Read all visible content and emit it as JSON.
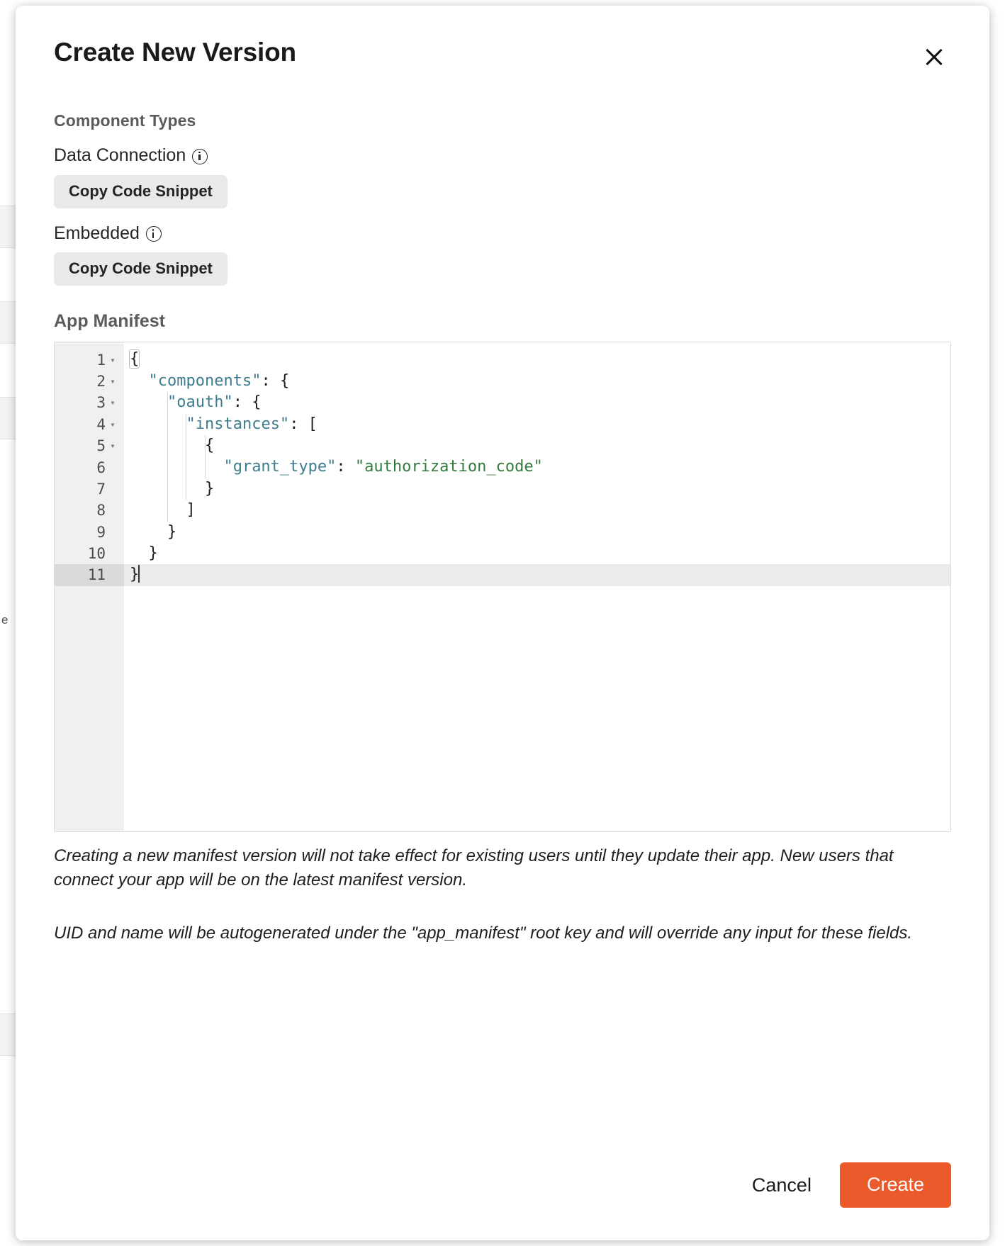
{
  "dialog": {
    "title": "Create New Version",
    "close_label": "×"
  },
  "component_types": {
    "heading": "Component Types",
    "items": [
      {
        "label": "Data Connection",
        "info_icon": "info-icon",
        "button_label": "Copy Code Snippet"
      },
      {
        "label": "Embedded",
        "info_icon": "info-icon",
        "button_label": "Copy Code Snippet"
      }
    ]
  },
  "manifest": {
    "heading": "App Manifest",
    "active_line": 11,
    "cursor_line": 11,
    "lines": [
      {
        "num": "1",
        "fold": "▾",
        "indent": 0,
        "text": "{"
      },
      {
        "num": "2",
        "fold": "▾",
        "indent": 1,
        "text": "\"components\": {"
      },
      {
        "num": "3",
        "fold": "▾",
        "indent": 2,
        "text": "\"oauth\": {"
      },
      {
        "num": "4",
        "fold": "▾",
        "indent": 3,
        "text": "\"instances\": ["
      },
      {
        "num": "5",
        "fold": "▾",
        "indent": 4,
        "text": "{"
      },
      {
        "num": "6",
        "fold": "",
        "indent": 5,
        "text": "\"grant_type\": \"authorization_code\""
      },
      {
        "num": "7",
        "fold": "",
        "indent": 4,
        "text": "}"
      },
      {
        "num": "8",
        "fold": "",
        "indent": 3,
        "text": "]"
      },
      {
        "num": "9",
        "fold": "",
        "indent": 2,
        "text": "}"
      },
      {
        "num": "10",
        "fold": "",
        "indent": 1,
        "text": "}"
      },
      {
        "num": "11",
        "fold": "",
        "indent": 0,
        "text": "}"
      }
    ],
    "json_value": {
      "components": {
        "oauth": {
          "instances": [
            {
              "grant_type": "authorization_code"
            }
          ]
        }
      }
    }
  },
  "notes": [
    "Creating a new manifest version will not take effect for existing users until they update their app. New users that connect your app will be on the latest manifest version.",
    "UID and name will be autogenerated under the \"app_manifest\" root key and will override any input for these fields."
  ],
  "footer": {
    "cancel_label": "Cancel",
    "create_label": "Create"
  },
  "background": {
    "edge_letter": "e"
  },
  "colors": {
    "accent": "#ea5a2a",
    "json_key": "#3d7d8f",
    "json_string": "#337b3d",
    "button_bg": "#e7e9ea",
    "gutter_bg": "#f0f0f0",
    "active_line": "#ebebeb"
  }
}
